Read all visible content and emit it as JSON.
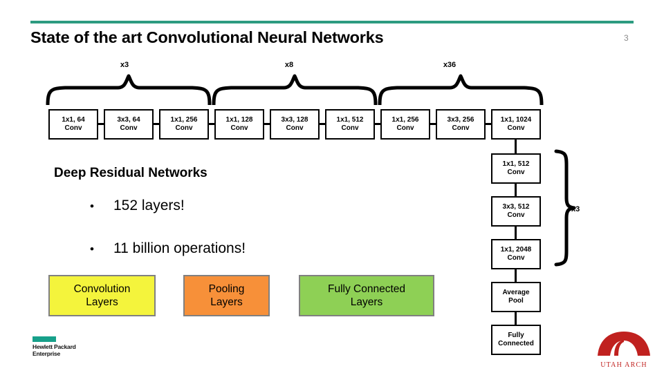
{
  "slide": {
    "title": "State of the art Convolutional Neural Networks",
    "page_number": "3",
    "accent_color": "#2d9b80"
  },
  "multipliers": [
    {
      "name": "group-1",
      "label": "x3"
    },
    {
      "name": "group-2",
      "label": "x8"
    },
    {
      "name": "group-3",
      "label": "x36"
    },
    {
      "name": "group-4",
      "label": "x3"
    }
  ],
  "top_row_boxes": [
    {
      "line1": "1x1, 64",
      "line2": "Conv"
    },
    {
      "line1": "3x3, 64",
      "line2": "Conv"
    },
    {
      "line1": "1x1, 256",
      "line2": "Conv"
    },
    {
      "line1": "1x1, 128",
      "line2": "Conv"
    },
    {
      "line1": "3x3, 128",
      "line2": "Conv"
    },
    {
      "line1": "1x1, 512",
      "line2": "Conv"
    },
    {
      "line1": "1x1, 256",
      "line2": "Conv"
    },
    {
      "line1": "3x3, 256",
      "line2": "Conv"
    },
    {
      "line1": "1x1, 1024",
      "line2": "Conv"
    }
  ],
  "right_column_boxes": [
    {
      "line1": "1x1, 512",
      "line2": "Conv"
    },
    {
      "line1": "3x3, 512",
      "line2": "Conv"
    },
    {
      "line1": "1x1, 2048",
      "line2": "Conv"
    },
    {
      "line1": "Average",
      "line2": "Pool"
    },
    {
      "line1": "Fully",
      "line2": "Connected"
    }
  ],
  "body": {
    "section_heading": "Deep Residual Networks",
    "bullets": [
      {
        "marker": "•",
        "text": "152 layers!"
      },
      {
        "marker": "•",
        "text": "11 billion operations!"
      }
    ]
  },
  "legend": [
    {
      "line1": "Convolution",
      "line2": "Layers",
      "color": "#f4f43c"
    },
    {
      "line1": "Pooling",
      "line2": "Layers",
      "color": "#f79039"
    },
    {
      "line1": "Fully Connected",
      "line2": "Layers",
      "color": "#8ed055"
    }
  ],
  "logos": {
    "hpe": {
      "line1": "Hewlett Packard",
      "line2": "Enterprise",
      "dash_color": "#17a08a"
    },
    "utah": {
      "label": "UTAH ARCH",
      "color": "#c0211f"
    }
  }
}
